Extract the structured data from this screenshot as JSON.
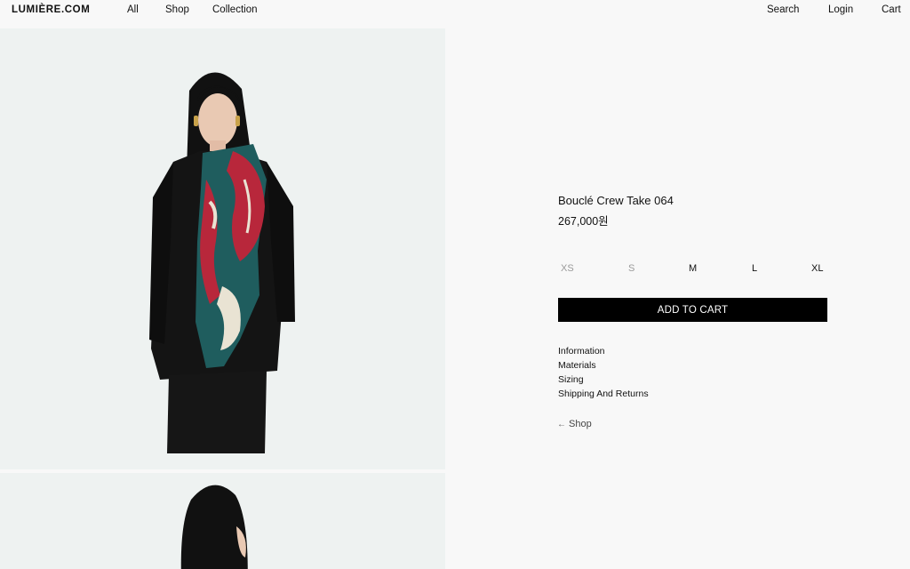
{
  "header": {
    "logo": "LUMIÈRE.COM",
    "nav_left": [
      "All",
      "Shop",
      "Collection"
    ],
    "nav_right": [
      "Search",
      "Login",
      "Cart"
    ]
  },
  "product": {
    "title": "Bouclé Crew Take 064",
    "price": "267,000원",
    "sizes": [
      {
        "label": "XS",
        "available": false
      },
      {
        "label": "S",
        "available": false
      },
      {
        "label": "M",
        "available": true
      },
      {
        "label": "L",
        "available": true
      },
      {
        "label": "XL",
        "available": true
      }
    ],
    "add_to_cart": "ADD TO CART",
    "info_links": [
      "Information",
      "Materials",
      "Sizing",
      "Shipping And Returns"
    ],
    "back_arrow": "←",
    "back_label": "Shop"
  },
  "colors": {
    "page_bg": "#f8f8f8",
    "photo_bg": "#eef2f1",
    "button_bg": "#000000",
    "button_text": "#ffffff",
    "unavailable_size": "#9a9a9a"
  }
}
